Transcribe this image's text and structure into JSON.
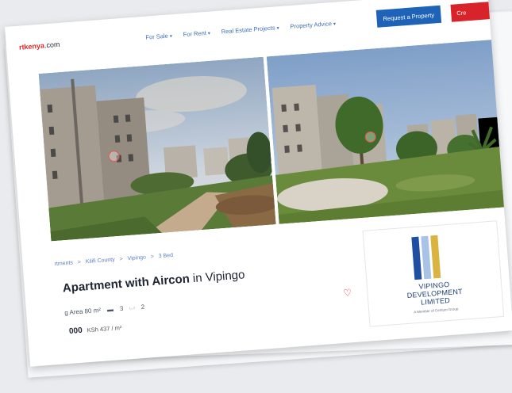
{
  "header": {
    "logo_prefix": "",
    "logo_accent": "rtkenya",
    "logo_suffix": ".com",
    "nav": [
      {
        "label": "For Sale"
      },
      {
        "label": "For Rent"
      },
      {
        "label": "Real Estate Projects"
      },
      {
        "label": "Property Advice"
      }
    ],
    "request_button": "Request a Property",
    "red_button": "Cre"
  },
  "listing": {
    "breadcrumb": [
      "rtments",
      ">",
      "Kilifi County",
      ">",
      "Vipingo",
      ">",
      "3 Bed"
    ],
    "title_main": "Apartment with Aircon ",
    "title_tail": "in Vipingo",
    "floor_area": "g Area 80 m²",
    "bedrooms": "3",
    "bathrooms": "2",
    "price": "000",
    "price_per_m2": "KSh 437 / m²"
  },
  "developer": {
    "name_line1": "VIPINGO",
    "name_line2": "DEVELOPMENT",
    "name_line3": "LIMITED",
    "subtitle": "A Member of Centum Group",
    "logo_colors": [
      "#1f4fa3",
      "#a9c3e6",
      "#d9b441"
    ]
  },
  "icons": {
    "dropdown": "chevron-down-icon",
    "camera": "camera-icon",
    "bed": "bed-icon",
    "bath": "bath-icon",
    "favorite": "heart-icon"
  }
}
